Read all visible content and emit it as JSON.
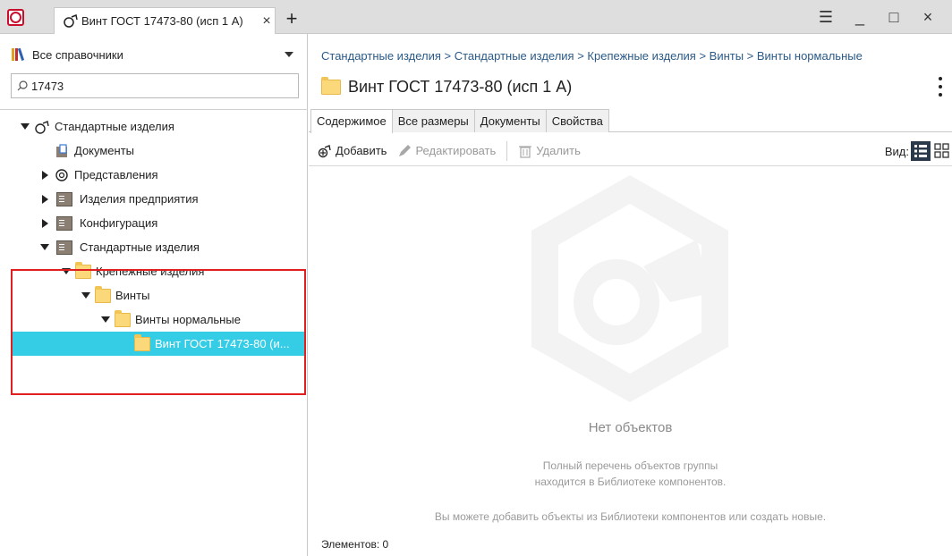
{
  "app": {
    "tab_title": "Винт ГОСТ 17473-80 (исп 1 А)",
    "tab_close": "×",
    "new_tab": "+"
  },
  "window_controls": {
    "menu": "☰",
    "minimize": "_",
    "maximize": "□",
    "close": "×"
  },
  "sidebar": {
    "directory_select": "Все справочники",
    "search_value": "17473",
    "tree": [
      {
        "label": "Стандартные изделия",
        "level": 0,
        "arrow": "down",
        "icon": "standard-parts-icon"
      },
      {
        "label": "Документы",
        "level": 1,
        "arrow": "none",
        "icon": "documents-icon"
      },
      {
        "label": "Представления",
        "level": 1,
        "arrow": "right",
        "icon": "representations-icon"
      },
      {
        "label": "Изделия предприятия",
        "level": 1,
        "arrow": "right",
        "icon": "book-icon"
      },
      {
        "label": "Конфигурация",
        "level": 1,
        "arrow": "right",
        "icon": "book-icon"
      },
      {
        "label": "Стандартные изделия",
        "level": 1,
        "arrow": "down",
        "icon": "book-icon"
      },
      {
        "label": "Крепежные изделия",
        "level": 2,
        "arrow": "down",
        "icon": "folder-icon"
      },
      {
        "label": "Винты",
        "level": 3,
        "arrow": "down",
        "icon": "folder-icon"
      },
      {
        "label": "Винты нормальные",
        "level": 4,
        "arrow": "down",
        "icon": "folder-icon"
      },
      {
        "label": "Винт ГОСТ 17473-80 (и...",
        "level": 5,
        "arrow": "none",
        "icon": "folder-icon",
        "selected": true
      }
    ]
  },
  "main": {
    "breadcrumb": "Стандартные изделия > Стандартные изделия > Крепежные изделия > Винты > Винты нормальные",
    "title": "Винт ГОСТ 17473-80 (исп 1 А)",
    "tabs": [
      "Содержимое",
      "Все размеры",
      "Документы",
      "Свойства"
    ],
    "toolbar": {
      "add": "Добавить",
      "edit": "Редактировать",
      "delete": "Удалить",
      "view_label": "Вид:"
    },
    "empty": {
      "title": "Нет объектов",
      "desc_line1": "Полный перечень объектов группы",
      "desc_line2": "находится в Библиотеке компонентов.",
      "hint": "Вы можете добавить объекты из Библиотеки компонентов или создать новые."
    },
    "status": "Элементов: 0"
  },
  "colors": {
    "accent_selected": "#35cce6",
    "highlight_border": "#e02020",
    "breadcrumb": "#2a5a88",
    "app_logo": "#c8102e"
  }
}
